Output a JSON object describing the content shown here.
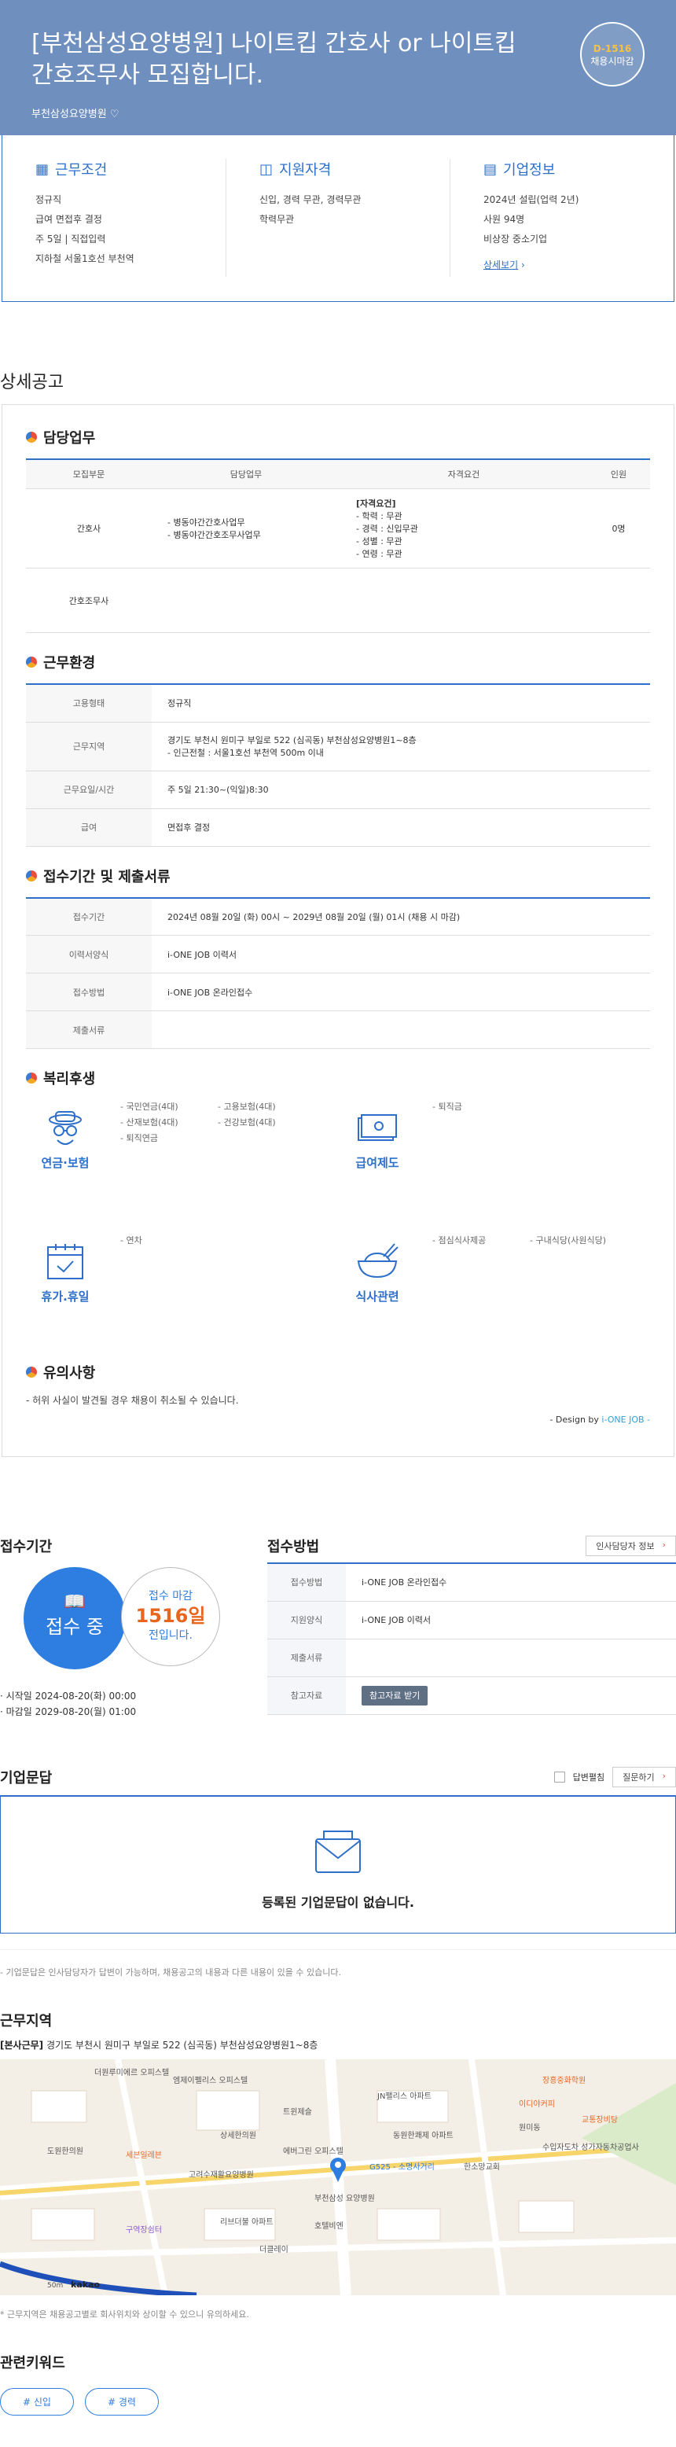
{
  "header": {
    "title": "[부천삼성요양병원] 나이트킵 간호사 or 나이트킵 간호조무사 모집합니다.",
    "company": "부천삼성요양병원",
    "dday": "D-1516",
    "dday_status": "채용시마감"
  },
  "summary": {
    "work": {
      "title": "근무조건",
      "items": [
        "정규직",
        "급여 면접후 결정",
        "주 5일 | 직접입력",
        "지하철 서울1호선 부천역"
      ]
    },
    "qual": {
      "title": "지원자격",
      "items": [
        "신입, 경력 무관, 경력무관",
        "학력무관"
      ]
    },
    "company": {
      "title": "기업정보",
      "items": [
        "2024년 설립(업력 2년)",
        "사원 94명",
        "비상장 중소기업"
      ],
      "more": "상세보기"
    }
  },
  "detail": {
    "title": "상세공고",
    "duty": {
      "title": "담당업무",
      "headers": [
        "모집부문",
        "담당업무",
        "자격요건",
        "인원"
      ],
      "rows": [
        {
          "part": "간호사",
          "task": "- 병동야간간호사업무\n- 병동야간간호조무사업무",
          "req_title": "[자격요건]",
          "req": "- 학력 : 무관\n- 경력 : 신입무관\n- 성별 : 무관\n- 연령 : 무관",
          "count": "0명"
        },
        {
          "part": "간호조무사",
          "task": "",
          "req_title": "",
          "req": "",
          "count": ""
        }
      ]
    },
    "env": {
      "title": "근무환경",
      "rows": [
        {
          "label": "고용형태",
          "value": "정규직"
        },
        {
          "label": "근무지역",
          "value": "경기도 부천시 원미구 부일로 522 (심곡동) 부천삼성요양병원1~8층\n- 인근전철 : 서울1호선 부천역 500m 이내"
        },
        {
          "label": "근무요일/시간",
          "value": "주 5일 21:30~(익일)8:30"
        },
        {
          "label": "급여",
          "value": "면접후 결정"
        }
      ]
    },
    "period": {
      "title": "접수기간 및 제출서류",
      "rows": [
        {
          "label": "접수기간",
          "value": "2024년 08월 20일 (화) 00시 ~ 2029년 08월 20일 (월) 01시 (채용 시 마감)"
        },
        {
          "label": "이력서양식",
          "value": "i-ONE JOB 이력서"
        },
        {
          "label": "접수방법",
          "value": "i-ONE JOB 온라인접수"
        },
        {
          "label": "제출서류",
          "value": ""
        }
      ]
    },
    "welfare": {
      "title": "복리후생",
      "groups": [
        {
          "name": "연금·보험",
          "icon": "insurance-icon",
          "items": [
            "- 국민연금(4대)",
            "- 고용보험(4대)",
            "- 산재보험(4대)",
            "- 건강보험(4대)",
            "- 퇴직연금"
          ]
        },
        {
          "name": "급여제도",
          "icon": "money-icon",
          "items": [
            "- 퇴직금"
          ]
        },
        {
          "name": "휴가.휴일",
          "icon": "calendar-icon",
          "items": [
            "- 연차"
          ]
        },
        {
          "name": "식사관련",
          "icon": "rice-bowl-icon",
          "items": [
            "- 점심식사제공",
            "- 구내식당(사원식당)"
          ]
        }
      ]
    },
    "notice": {
      "title": "유의사항",
      "text": "- 허위 사실이 발견될 경우 채용이 취소될 수 있습니다.",
      "design_prefix": "- Design by ",
      "design_brand": "i-ONE JOB",
      "design_suffix": " -"
    }
  },
  "apply": {
    "title": "접수기간",
    "status": "접수 중",
    "deadline_label": "접수 마감",
    "days_left": "1516일",
    "days_suffix": "전입니다.",
    "start": "· 시작일 2024-08-20(화) 00:00",
    "end": "· 마감일 2029-08-20(월) 01:00",
    "method_title": "접수방법",
    "contact_btn": "인사담당자 정보",
    "rows": [
      {
        "label": "접수방법",
        "value": "i-ONE JOB 온라인접수"
      },
      {
        "label": "지원양식",
        "value": "i-ONE JOB 이력서"
      },
      {
        "label": "제출서류",
        "value": ""
      },
      {
        "label": "참고자료",
        "value": "참고자료 받기"
      }
    ]
  },
  "qna": {
    "title": "기업문답",
    "answered_label": "답변펼침",
    "ask_btn": "질문하기",
    "empty": "등록된 기업문답이 없습니다.",
    "note": "- 기업문답은 인사담당자가 답변이 가능하며, 채용공고의 내용과 다른 내용이 있을 수 있습니다."
  },
  "location": {
    "title": "근무지역",
    "tag": "[본사근무]",
    "address": "경기도 부천시 원미구 부일로 522 (심곡동) 부천삼성요양병원1~8층",
    "map_labels": [
      "더원루미에르 오피스텔",
      "엠제이펠리스 오피스텔",
      "트윈제슬",
      "상세한의원",
      "도원한의원",
      "세븐일레븐",
      "고려수재활요양병원",
      "에버그린 오피스텔",
      "부천삼성 요양병원",
      "G525 - 소명사거리",
      "한소망교회",
      "원미동",
      "구역장쉼터",
      "리브더불 아파트",
      "호텔비엔",
      "더클레이",
      "장흥중화학원",
      "이디야커피",
      "교통장비탕",
      "JN팰리스 아파트",
      "동원한쾌제 아파트",
      "수입자도차 성가자동차공업사",
      "50m",
      "kakao"
    ],
    "note": "* 근무지역은 채용공고별로 회사위치와 상이할 수 있으니 유의하세요."
  },
  "keywords": {
    "title": "관련키워드",
    "tags": [
      "# 신입",
      "# 경력"
    ]
  }
}
